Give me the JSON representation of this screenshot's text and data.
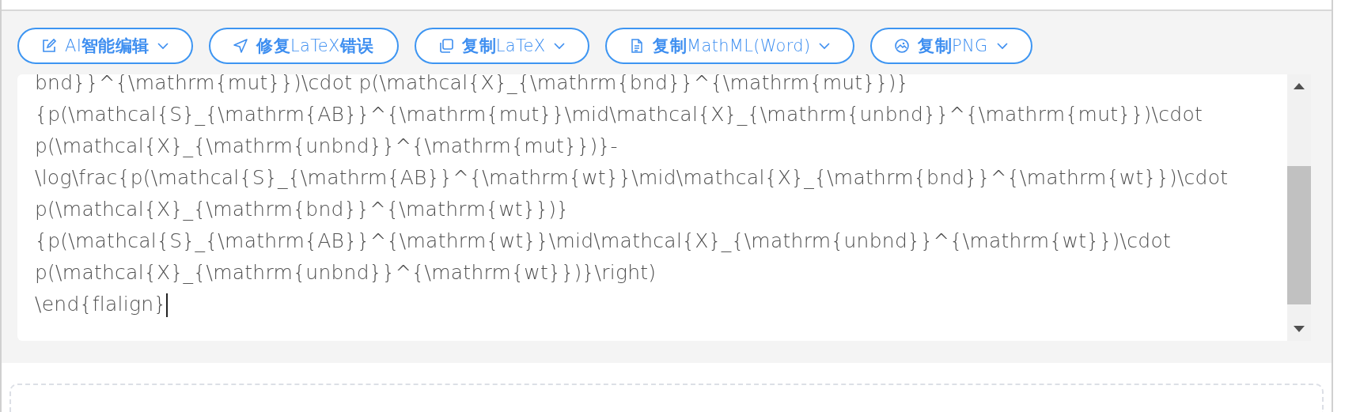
{
  "toolbar": {
    "buttons": [
      {
        "label": "AI**智能编辑**",
        "kind": "edit",
        "dropdown": true
      },
      {
        "label": "**修复**LaTeX**错误**",
        "kind": "send",
        "dropdown": false
      },
      {
        "label": "**复制**LaTeX",
        "kind": "copy",
        "dropdown": true
      },
      {
        "label": "**复制**MathML(Word)",
        "kind": "document",
        "dropdown": true
      },
      {
        "label": "**复制**PNG",
        "kind": "image",
        "dropdown": true
      }
    ]
  },
  "editor": {
    "lines": [
      "bnd}}^{\\mathrm{mut}})\\cdot p(\\mathcal{X}_{\\mathrm{bnd}}^{\\mathrm{mut}})}",
      "{p(\\mathcal{S}_{\\mathrm{AB}}^{\\mathrm{mut}}\\mid\\mathcal{X}_{\\mathrm{unbnd}}^{\\mathrm{mut}})\\cdot",
      "p(\\mathcal{X}_{\\mathrm{unbnd}}^{\\mathrm{mut}})}-",
      "\\log\\frac{p(\\mathcal{S}_{\\mathrm{AB}}^{\\mathrm{wt}}\\mid\\mathcal{X}_{\\mathrm{bnd}}^{\\mathrm{wt}})\\cdot",
      "p(\\mathcal{X}_{\\mathrm{bnd}}^{\\mathrm{wt}})}",
      "{p(\\mathcal{S}_{\\mathrm{AB}}^{\\mathrm{wt}}\\mid\\mathcal{X}_{\\mathrm{unbnd}}^{\\mathrm{wt}})\\cdot",
      "p(\\mathcal{X}_{\\mathrm{unbnd}}^{\\mathrm{wt}})}\\right)",
      "\\end{flalign}"
    ]
  }
}
